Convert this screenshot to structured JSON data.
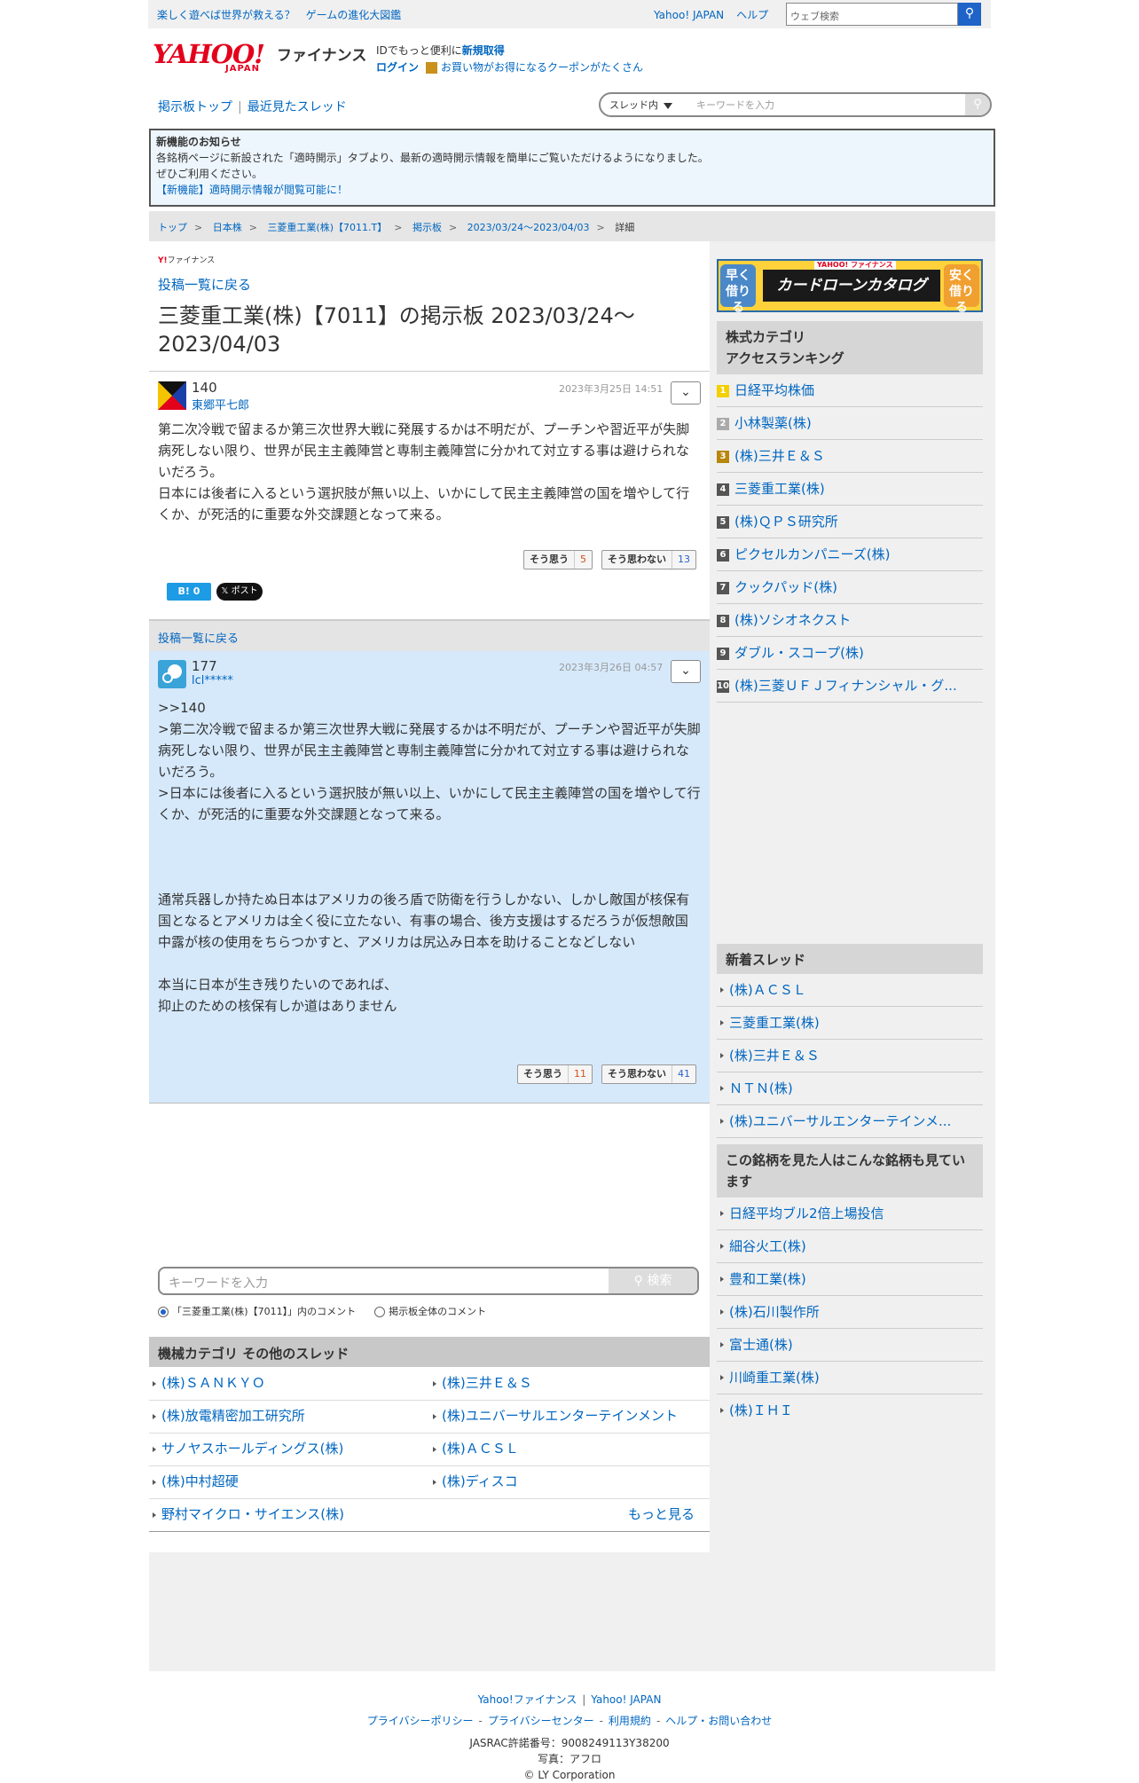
{
  "topbar": {
    "promo1": "楽しく遊べば世界が救える？",
    "promo2": "ゲームの進化大図鑑",
    "link_yj": "Yahoo! JAPAN",
    "link_help": "ヘルプ",
    "search_placeholder": "ウェブ検索"
  },
  "header": {
    "logo": "YAHOO!",
    "logo_sub": "JAPAN",
    "finance": "ファイナンス",
    "id_text": "IDでもっと便利に",
    "signup": "新規取得",
    "login": "ログイン",
    "coupon_text": "お買い物がお得になるクーポンがたくさん"
  },
  "nav": {
    "board_top": "掲示板トップ",
    "recent": "最近見たスレッド",
    "scope": "スレッド内",
    "keyword_placeholder": "キーワードを入力"
  },
  "notice": {
    "title": "新機能のお知らせ",
    "line1": "各銘柄ページに新設された「適時開示」タブより、最新の適時開示情報を簡単にご覧いただけるようになりました。",
    "line2": "ぜひご利用ください。",
    "link": "【新機能】適時開示情報が閲覧可能に！"
  },
  "breadcrumb": [
    "トップ",
    "日本株",
    "三菱重工業(株)【7011.T】",
    "掲示板",
    "2023/03/24〜2023/04/03",
    "詳細"
  ],
  "page": {
    "small_logo": "Y!",
    "small_logo_text": "ファイナンス",
    "back_label": "投稿一覧に戻る",
    "title": "三菱重工業(株)【7011】の掲示板 2023/03/24〜2023/04/03"
  },
  "posts": [
    {
      "num": "140",
      "user": "東郷平七郎",
      "date": "2023年3月25日 14:51",
      "body": "第二次冷戦で留まるか第三次世界大戦に発展するかは不明だが、プーチンや習近平が失脚病死しない限り、世界が民主主義陣営と専制主義陣営に分かれて対立する事は避けられないだろう。\n日本には後者に入るという選択肢が無い以上、いかにして民主主義陣営の国を増やして行くか、が死活的に重要な外交課題となって来る。",
      "agree_label": "そう思う",
      "agree": "5",
      "disagree_label": "そう思わない",
      "disagree": "13"
    },
    {
      "num": "177",
      "user": "lcl*****",
      "date": "2023年3月26日 04:57",
      "body": ">>140\n>第二次冷戦で留まるか第三次世界大戦に発展するかは不明だが、プーチンや習近平が失脚病死しない限り、世界が民主主義陣営と専制主義陣営に分かれて対立する事は避けられないだろう。\n>日本には後者に入るという選択肢が無い以上、いかにして民主主義陣営の国を増やして行くか、が死活的に重要な外交課題となって来る。\n\n\n\n通常兵器しか持たぬ日本はアメリカの後ろ盾で防衛を行うしかない、しかし敵国が核保有国となるとアメリカは全く役に立たない、有事の場合、後方支援はするだろうが仮想敵国中露が核の使用をちらつかすと、アメリカは尻込み日本を助けることなどしない\n\n本当に日本が生き残りたいのであれば、\n抑止のための核保有しか道はありません",
      "agree_label": "そう思う",
      "agree": "11",
      "disagree_label": "そう思わない",
      "disagree": "41"
    }
  ],
  "share": {
    "hatena": "B! 0",
    "x": "𝕏 ポスト"
  },
  "bottom_search": {
    "placeholder": "キーワードを入力",
    "button": "検索",
    "radio1": "「三菱重工業(株)【7011】」内のコメント",
    "radio2": "掲示板全体のコメント"
  },
  "other_threads": {
    "heading": "機械カテゴリ その他のスレッド",
    "items": [
      "(株)ＳＡＮＫＹＯ",
      "(株)三井Ｅ＆Ｓ",
      "(株)放電精密加工研究所",
      "(株)ユニバーサルエンターテインメント",
      "サノヤスホールディングス(株)",
      "(株)ＡＣＳＬ",
      "(株)中村超硬",
      "(株)ディスコ",
      "野村マイクロ・サイエンス(株)"
    ],
    "more": "もっと見る"
  },
  "sidebar": {
    "ad": {
      "left": "早く借りる",
      "right": "安く借りる",
      "brand": "YAHOO! ファイナンス",
      "main": "カードローンカタログ"
    },
    "ranking_heading1": "株式カテゴリ",
    "ranking_heading2": "アクセスランキング",
    "ranking": [
      "日経平均株価",
      "小林製薬(株)",
      "(株)三井Ｅ＆Ｓ",
      "三菱重工業(株)",
      "(株)ＱＰＳ研究所",
      "ピクセルカンパニーズ(株)",
      "クックパッド(株)",
      "(株)ソシオネクスト",
      "ダブル・スコープ(株)",
      "(株)三菱ＵＦＪフィナンシャル・グ..."
    ],
    "new_heading": "新着スレッド",
    "new_threads": [
      "(株)ＡＣＳＬ",
      "三菱重工業(株)",
      "(株)三井Ｅ＆Ｓ",
      "ＮＴＮ(株)",
      "(株)ユニバーサルエンターテインメ..."
    ],
    "also_heading": "この銘柄を見た人はこんな銘柄も見ています",
    "also": [
      "日経平均ブル2倍上場投信",
      "細谷火工(株)",
      "豊和工業(株)",
      "(株)石川製作所",
      "富士通(株)",
      "川崎重工業(株)",
      "(株)ＩＨＩ"
    ]
  },
  "footer": {
    "l1a": "Yahoo!ファイナンス",
    "l1b": "Yahoo! JAPAN",
    "privacy": "プライバシーポリシー",
    "privacy_center": "プライバシーセンター",
    "terms": "利用規約",
    "help": "ヘルプ・お問い合わせ",
    "jasrac": "JASRAC許諾番号：9008249113Y38200",
    "photo": "写真：アフロ",
    "copy": "© LY Corporation"
  }
}
